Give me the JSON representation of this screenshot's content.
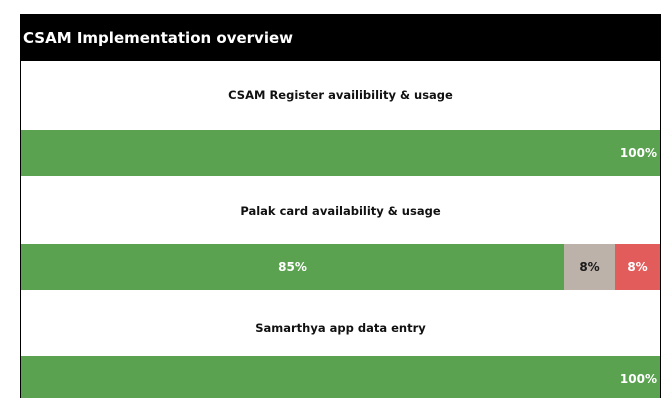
{
  "header": {
    "title": "CSAM Implementation overview"
  },
  "colors": {
    "green": "#5aa150",
    "gray": "#bcb2aa",
    "red": "#e25c5c",
    "header_bg": "#000000"
  },
  "chart_data": {
    "type": "bar",
    "title": "CSAM Implementation overview",
    "stacked": true,
    "orientation": "horizontal",
    "categories": [
      "CSAM Register availibility & usage",
      "Palak card availability & usage",
      "Samarthya app data entry"
    ],
    "series": [
      {
        "color": "#5aa150",
        "values": [
          100,
          85,
          100
        ],
        "labels": [
          "100%",
          "85%",
          "100%"
        ]
      },
      {
        "color": "#bcb2aa",
        "values": [
          0,
          8,
          0
        ],
        "labels": [
          "",
          "8%",
          ""
        ]
      },
      {
        "color": "#e25c5c",
        "values": [
          0,
          8,
          0
        ],
        "labels": [
          "",
          "8%",
          ""
        ]
      }
    ],
    "xlim": [
      0,
      100
    ],
    "grid": false,
    "legend": "none"
  }
}
